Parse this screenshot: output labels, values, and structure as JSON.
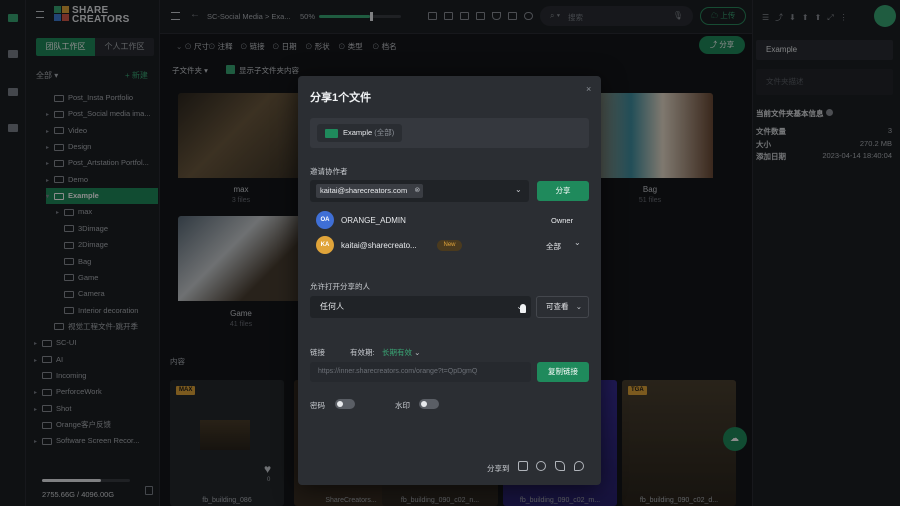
{
  "sidebar": {
    "logo_text": "SHARE CREATORS",
    "tabs": [
      "团队工作区",
      "个人工作区"
    ],
    "all_label": "全部",
    "new_label": "+ 新建",
    "tree": [
      {
        "label": "Post_Insta Portfolio",
        "indent": 1,
        "arrow": false
      },
      {
        "label": "Post_Social media ima...",
        "indent": 1,
        "arrow": true
      },
      {
        "label": "Video",
        "indent": 1,
        "arrow": true
      },
      {
        "label": "Design",
        "indent": 1,
        "arrow": true
      },
      {
        "label": "Post_Artstation Portfol...",
        "indent": 1,
        "arrow": true
      },
      {
        "label": "Demo",
        "indent": 1,
        "arrow": true
      },
      {
        "label": "Example",
        "indent": 1,
        "arrow": true,
        "selected": true
      },
      {
        "label": "max",
        "indent": 2,
        "arrow": true
      },
      {
        "label": "3Dimage",
        "indent": 2,
        "arrow": false
      },
      {
        "label": "2Dimage",
        "indent": 2,
        "arrow": false
      },
      {
        "label": "Bag",
        "indent": 2,
        "arrow": false
      },
      {
        "label": "Game",
        "indent": 2,
        "arrow": false
      },
      {
        "label": "Camera",
        "indent": 2,
        "arrow": false
      },
      {
        "label": "Interior decoration",
        "indent": 2,
        "arrow": false
      },
      {
        "label": "视觉工程文件-跳开季",
        "indent": 1,
        "arrow": false
      },
      {
        "label": "SC-UI",
        "indent": 0,
        "arrow": true
      },
      {
        "label": "AI",
        "indent": 0,
        "arrow": true
      },
      {
        "label": "Incoming",
        "indent": 0,
        "arrow": false
      },
      {
        "label": "PerforceWork",
        "indent": 0,
        "arrow": true
      },
      {
        "label": "Shot",
        "indent": 0,
        "arrow": true
      },
      {
        "label": "Orange客户反馈",
        "indent": 0,
        "arrow": false
      },
      {
        "label": "Software Screen Recor...",
        "indent": 0,
        "arrow": true
      }
    ],
    "storage_text": "2755.66G / 4096.00G",
    "storage_fraction": 0.67
  },
  "topbar": {
    "breadcrumb": "SC-Social Media  >  Exa...",
    "zoom": "50%",
    "zoom_fraction": 0.62,
    "search_placeholder": "搜索",
    "upload_label": "上传"
  },
  "filters": [
    "尺寸",
    "注释",
    "链接",
    "日期",
    "形状",
    "类型",
    "档名"
  ],
  "share_button": "分享",
  "subfolder": {
    "label": "子文件夹",
    "show_label": "显示子文件夹内容"
  },
  "folders": [
    {
      "name": "max",
      "count": "3 files"
    },
    {
      "name": "Bag",
      "count": "51 files"
    },
    {
      "name": "Game",
      "count": "41 files"
    }
  ],
  "content_label": "内容",
  "files": [
    {
      "tag": "MAX",
      "name": "fb_building_086"
    },
    {
      "tag": "",
      "name": "ShareCreators..."
    },
    {
      "tag": "",
      "name": "fb_building_090_c02_n..."
    },
    {
      "tag": "",
      "name": "fb_building_090_c02_m..."
    },
    {
      "tag": "TGA",
      "name": "fb_building_090_c02_d..."
    }
  ],
  "heart_count": "0",
  "right_panel": {
    "folder_name": "Example",
    "desc_placeholder": "文件夹描述",
    "info_title": "当前文件夹基本信息",
    "rows": [
      {
        "key": "文件数量",
        "value": "3"
      },
      {
        "key": "大小",
        "value": "270.2 MB"
      },
      {
        "key": "添加日期",
        "value": "2023-04-14 18:40:04"
      }
    ]
  },
  "modal": {
    "title": "分享1个文件",
    "folder_chip": "Example",
    "folder_chip_sub": "(全部)",
    "invite_label": "邀请协作者",
    "invite_email": "kaitai@sharecreators.com",
    "share_label": "分享",
    "members": [
      {
        "initials": "OA",
        "name": "ORANGE_ADMIN",
        "role": "Owner",
        "color": "#3f6fd6"
      },
      {
        "initials": "KA",
        "name": "kaitai@sharecreato...",
        "role": "全部",
        "color": "#e0a43a",
        "new": "New"
      }
    ],
    "allow_label": "允许打开分享的人",
    "who_value": "任何人",
    "perm_value": "可查看",
    "link_label": "链接",
    "validity_label": "有效期:",
    "validity_value": "长期有效",
    "link_url": "https://inner.sharecreators.com/orange?t=QpDgmQ",
    "copy_label": "复制链接",
    "password_label": "密码",
    "watermark_label": "水印",
    "share_to_label": "分享到"
  }
}
